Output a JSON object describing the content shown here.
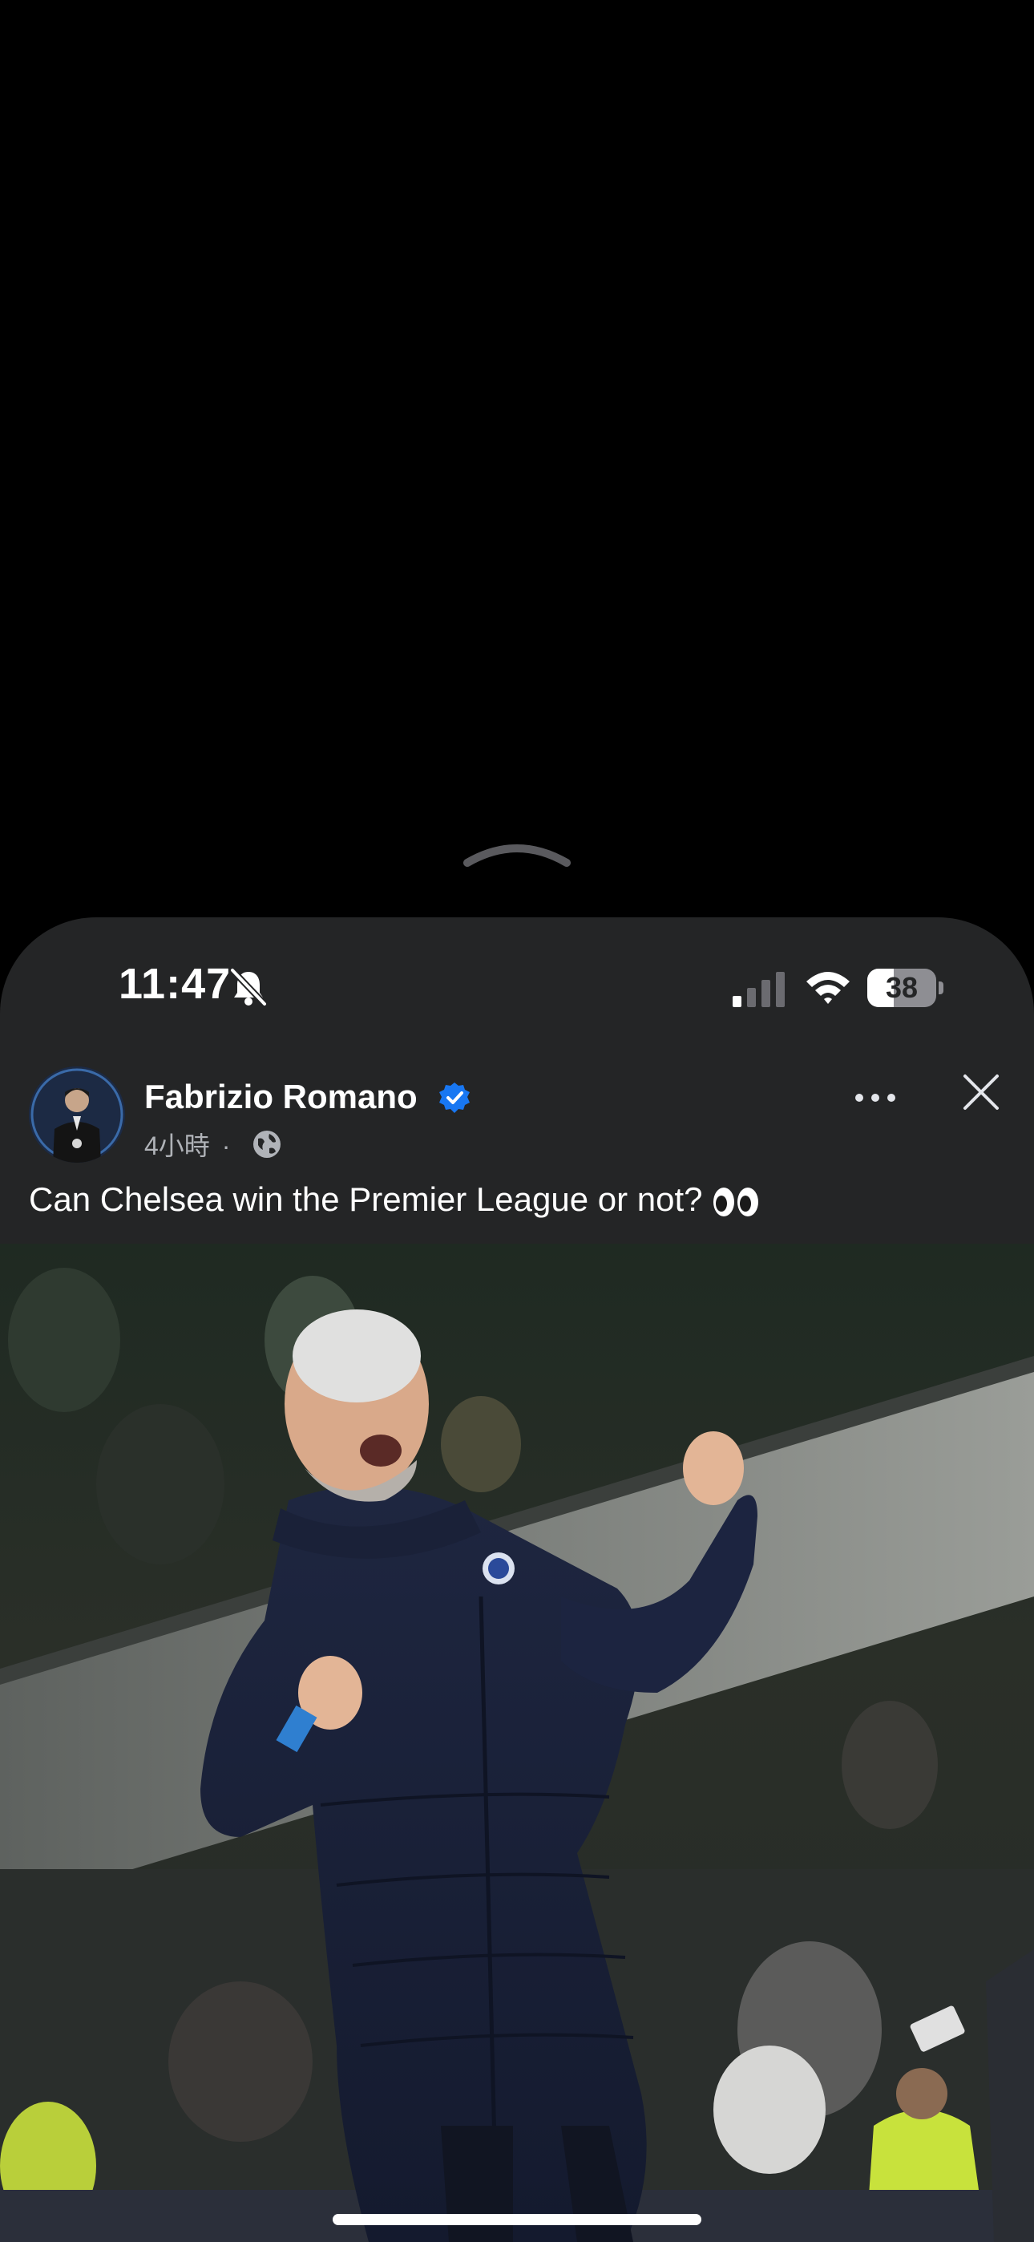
{
  "status_bar": {
    "time": "11:47",
    "battery_level": "38",
    "battery_fraction": 0.38,
    "icons": [
      "bell-muted-icon",
      "cellular-signal-icon",
      "wifi-icon",
      "battery-icon"
    ]
  },
  "post": {
    "author": "Fabrizio Romano",
    "verified_icon": "verified-badge-icon",
    "time_ago": "4小時",
    "separator": "·",
    "audience_icon": "globe-icon",
    "caption": "Can Chelsea win the Premier League or not?",
    "caption_emoji_icon": "eyes-emoji-icon",
    "more_icon": "more-options-icon",
    "close_icon": "close-icon"
  },
  "colors": {
    "background": "#000000",
    "sheet": "#242526",
    "verified": "#1877F2",
    "secondary_text": "#b0b3b8"
  }
}
